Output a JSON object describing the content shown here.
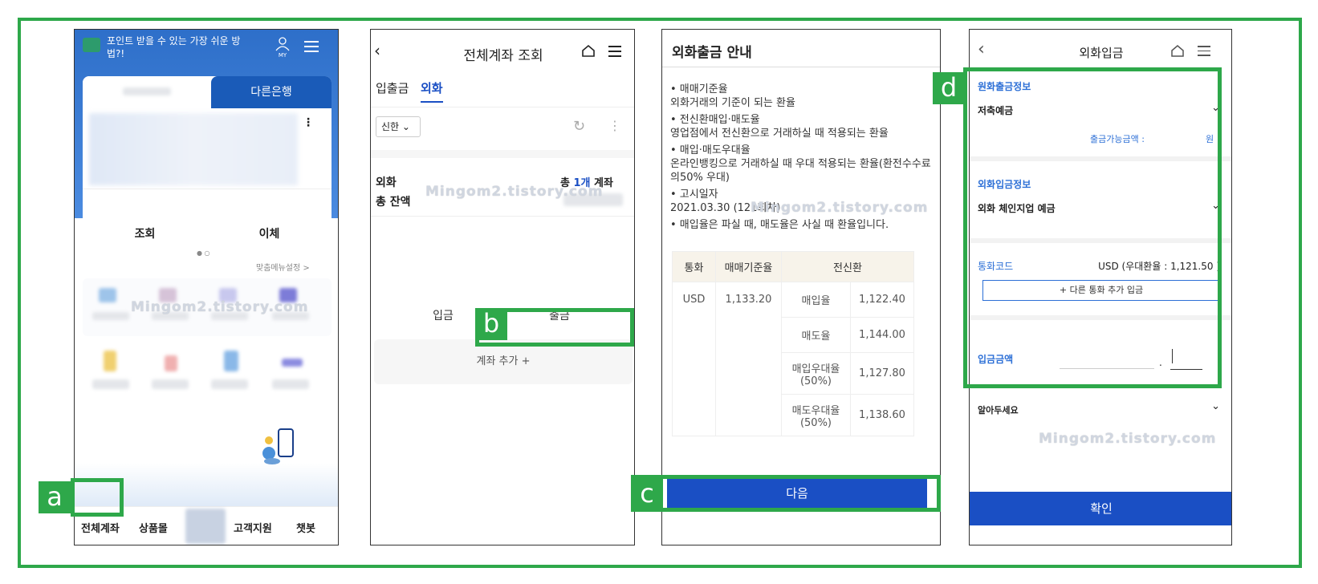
{
  "panel1": {
    "banner_text": "포인트 받을 수 있는 가장 쉬운 방법?!",
    "my_label": "MY",
    "other_bank_tab": "다른은행",
    "action_inquiry": "조회",
    "action_transfer": "이체",
    "custom_menu": "맞춤메뉴설정 >",
    "nav": [
      "전체계좌",
      "상품몰",
      "고객지원",
      "챗봇"
    ],
    "callout_label": "a"
  },
  "panel2": {
    "title": "전체계좌 조회",
    "tab_deposit": "입출금",
    "tab_fx": "외화",
    "bank_select": "신한",
    "fx_label": "외화",
    "total_balance_label": "총 잔액",
    "count_prefix": "총 ",
    "count_value": "1개",
    "count_suffix": " 계좌",
    "deposit_btn": "입금",
    "withdraw_btn": "출금",
    "add_account": "계좌 추가 +",
    "callout_label": "b"
  },
  "panel3": {
    "title": "외화출금 안내",
    "info": [
      "• 매매기준율\n  외화거래의 기준이 되는 환율",
      "• 전신환매입·매도율\n  영업점에서 전신환으로 거래하실 때 적용되는 환율",
      "• 매입·매도우대율\n  온라인뱅킹으로 거래하실 때 우대 적용되는 환율(환전수수료의50% 우대)",
      "• 고시일자\n  2021.03.30 (121회차)",
      "• 매입율은 파실 때, 매도율은 사실 때 환율입니다."
    ],
    "table": {
      "head_currency": "통화",
      "head_base": "매매기준율",
      "head_tt": "전신환",
      "currency": "USD",
      "base_rate": "1,133.20",
      "rows": [
        {
          "label": "매입율",
          "value": "1,122.40"
        },
        {
          "label": "매도율",
          "value": "1,144.00"
        },
        {
          "label": "매입우대율\n(50%)",
          "value": "1,127.80"
        },
        {
          "label": "매도우대율\n(50%)",
          "value": "1,138.60"
        }
      ]
    },
    "next_btn": "다음",
    "callout_label": "c"
  },
  "panel4": {
    "title": "외화입금",
    "src_label": "원화출금정보",
    "src_value": "저축예금",
    "available_label": "출금가능금액 :",
    "available_unit": "원",
    "dst_label": "외화입금정보",
    "dst_value": "외화 체인지업 예금",
    "currency_label": "통화코드",
    "currency_value": "USD (우대환율 : 1,121.50 )",
    "add_currency_btn": "+ 다른 통화 추가 입금",
    "amount_label": "입금금액",
    "notice_label": "알아두세요",
    "ok_btn": "확인",
    "callout_label": "d"
  },
  "watermark": "Mingom2.tistory.com",
  "colors": {
    "accent_green": "#2ea84a",
    "primary_blue": "#1a4fc4"
  }
}
